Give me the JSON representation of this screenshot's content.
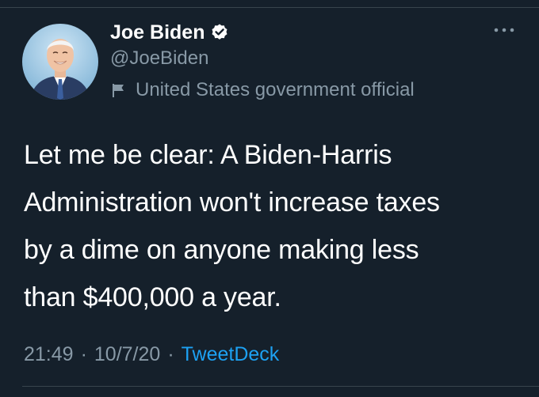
{
  "tweet": {
    "author": {
      "name": "Joe Biden",
      "handle": "@JoeBiden",
      "label": "United States government official"
    },
    "text": "Let me be clear: A Biden-Harris\nAdministration won't increase taxes\nby a dime on anyone making less\nthan $400,000 a year.",
    "time": "21:49",
    "separator": "·",
    "date": "10/7/20",
    "source": "TweetDeck"
  },
  "icons": {
    "verified": "verified-badge-icon",
    "label": "flag-icon",
    "more": "more-dots-icon"
  },
  "colors": {
    "background": "#15202b",
    "primary_text": "#ffffff",
    "secondary_text": "#8899a6",
    "link": "#1da1f2",
    "divider": "#38444d"
  }
}
